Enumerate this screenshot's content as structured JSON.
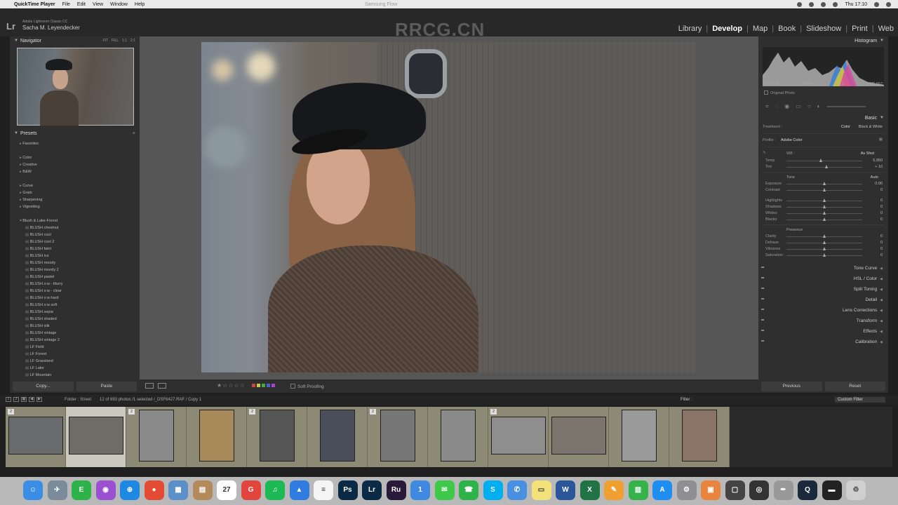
{
  "menubar": {
    "app": "QuickTime Player",
    "items": [
      "File",
      "Edit",
      "View",
      "Window",
      "Help"
    ],
    "doc_title": "Samsung Flow",
    "clock": "Thu 17:10"
  },
  "lr": {
    "product": "Adobe Lightroom Classic CC",
    "user": "Sacha M. Leyendecker",
    "watermark": "RRCG.CN",
    "modules": [
      "Library",
      "Develop",
      "Map",
      "Book",
      "Slideshow",
      "Print",
      "Web"
    ],
    "active_module": "Develop"
  },
  "left": {
    "navigator_title": "Navigator",
    "nav_opts": [
      "FIT",
      "FILL",
      "1:1",
      "2:1"
    ],
    "presets_title": "Presets",
    "presets": [
      {
        "label": "Favorites",
        "kind": "grp",
        "gap": false
      },
      {
        "label": "Color",
        "kind": "grp",
        "gap": true
      },
      {
        "label": "Creative",
        "kind": "grp",
        "gap": false
      },
      {
        "label": "B&W",
        "kind": "grp",
        "gap": false
      },
      {
        "label": "Curve",
        "kind": "grp",
        "gap": true
      },
      {
        "label": "Grain",
        "kind": "grp",
        "gap": false
      },
      {
        "label": "Sharpening",
        "kind": "grp",
        "gap": false
      },
      {
        "label": "Vignetting",
        "kind": "grp",
        "gap": false
      },
      {
        "label": "Blush & Lake-Forest",
        "kind": "open",
        "gap": true
      },
      {
        "label": "BLUSH chestnut",
        "kind": "sub",
        "gap": false
      },
      {
        "label": "BLUSH cool",
        "kind": "sub",
        "gap": false
      },
      {
        "label": "BLUSH cool 2",
        "kind": "sub",
        "gap": false
      },
      {
        "label": "BLUSH faint",
        "kind": "sub",
        "gap": false
      },
      {
        "label": "BLUSH ice",
        "kind": "sub",
        "gap": false
      },
      {
        "label": "BLUSH moody",
        "kind": "sub",
        "gap": false
      },
      {
        "label": "BLUSH moody 2",
        "kind": "sub",
        "gap": false
      },
      {
        "label": "BLUSH pastel",
        "kind": "sub",
        "gap": false
      },
      {
        "label": "BLUSH s:w - blurry",
        "kind": "sub",
        "gap": false
      },
      {
        "label": "BLUSH s:w - clear",
        "kind": "sub",
        "gap": false
      },
      {
        "label": "BLUSH s:w hard",
        "kind": "sub",
        "gap": false
      },
      {
        "label": "BLUSH s:w soft",
        "kind": "sub",
        "gap": false
      },
      {
        "label": "BLUSH sepia",
        "kind": "sub",
        "gap": false
      },
      {
        "label": "BLUSH shaded",
        "kind": "sub",
        "gap": false
      },
      {
        "label": "BLUSH silk",
        "kind": "sub",
        "gap": false
      },
      {
        "label": "BLUSH vintage",
        "kind": "sub",
        "gap": false
      },
      {
        "label": "BLUSH vintage 2",
        "kind": "sub",
        "gap": false
      },
      {
        "label": "LF Field",
        "kind": "sub",
        "gap": false
      },
      {
        "label": "LF Forest",
        "kind": "sub",
        "gap": false
      },
      {
        "label": "LF Grassland",
        "kind": "sub",
        "gap": false
      },
      {
        "label": "LF Lake",
        "kind": "sub",
        "gap": false
      },
      {
        "label": "LF Mountain",
        "kind": "sub",
        "gap": false
      }
    ],
    "copy_label": "Copy...",
    "paste_label": "Paste"
  },
  "toolbar": {
    "soft_proofing": "Soft Proofing"
  },
  "right": {
    "histogram_title": "Histogram",
    "iso": "ISO 1600",
    "focal": "56 mm",
    "aperture": "f / 1.2",
    "shutter": "1/125 SEC",
    "original_photo": "Original Photo",
    "basic_title": "Basic",
    "treatment_label": "Treatment :",
    "treatment_color": "Color",
    "treatment_bw": "Black & White",
    "profile_label": "Profile :",
    "profile_value": "Adobe Color",
    "wb_label": "WB :",
    "wb_value": "As Shot",
    "tone_label": "Tone",
    "auto_label": "Auto",
    "presence_label": "Presence",
    "wb_sliders": [
      {
        "label": "Temp",
        "value": "5,950",
        "pos": 0.45
      },
      {
        "label": "Tint",
        "value": "+ 10",
        "pos": 0.53
      }
    ],
    "tone_sliders": [
      {
        "label": "Exposure",
        "value": "0.00",
        "pos": 0.5
      },
      {
        "label": "Contrast",
        "value": "0",
        "pos": 0.5
      }
    ],
    "tone_sliders2": [
      {
        "label": "Highlights",
        "value": "0",
        "pos": 0.5
      },
      {
        "label": "Shadows",
        "value": "0",
        "pos": 0.5
      },
      {
        "label": "Whites",
        "value": "0",
        "pos": 0.5
      },
      {
        "label": "Blacks",
        "value": "0",
        "pos": 0.5
      }
    ],
    "presence_sliders": [
      {
        "label": "Clarity",
        "value": "0",
        "pos": 0.5
      },
      {
        "label": "Dehaze",
        "value": "0",
        "pos": 0.5
      },
      {
        "label": "Vibrance",
        "value": "0",
        "pos": 0.5
      },
      {
        "label": "Saturation",
        "value": "0",
        "pos": 0.5
      }
    ],
    "panels": [
      "Tone Curve",
      "HSL / Color",
      "Split Toning",
      "Detail",
      "Lens Corrections",
      "Transform",
      "Effects",
      "Calibration"
    ],
    "previous_label": "Previous",
    "reset_label": "Reset"
  },
  "filmbar": {
    "folder": "Folder : Street",
    "selection": "12 of 893 photos /1 selected /_DSF6427.RAF / Copy 1",
    "filter_label": "Filter :",
    "custom_filter": "Custom Filter",
    "page_nums": [
      "1",
      "2"
    ]
  },
  "filmstrip": {
    "frames": [
      {
        "badge": "2",
        "selected": false,
        "orient": "land",
        "tone": "#6a6b6d"
      },
      {
        "badge": "",
        "selected": true,
        "orient": "land",
        "tone": "#6f6c68"
      },
      {
        "badge": "2",
        "selected": false,
        "orient": "port",
        "tone": "#8a8a8a"
      },
      {
        "badge": "",
        "selected": false,
        "orient": "port",
        "tone": "#a88a5a"
      },
      {
        "badge": "2",
        "selected": false,
        "orient": "port",
        "tone": "#555555"
      },
      {
        "badge": "",
        "selected": false,
        "orient": "port",
        "tone": "#4a4e5a"
      },
      {
        "badge": "2",
        "selected": false,
        "orient": "port",
        "tone": "#777777"
      },
      {
        "badge": "",
        "selected": false,
        "orient": "port",
        "tone": "#8a8a8a"
      },
      {
        "badge": "2",
        "selected": false,
        "orient": "land",
        "tone": "#8e8e8e"
      },
      {
        "badge": "",
        "selected": false,
        "orient": "land",
        "tone": "#7c756e"
      },
      {
        "badge": "",
        "selected": false,
        "orient": "port",
        "tone": "#9a9a9a"
      },
      {
        "badge": "",
        "selected": false,
        "orient": "port",
        "tone": "#8a7468"
      }
    ]
  },
  "dock": {
    "apps": [
      {
        "name": "finder-icon",
        "color": "#3a8ee6",
        "glyph": "☺"
      },
      {
        "name": "launchpad-icon",
        "color": "#7c8b99",
        "glyph": "✈"
      },
      {
        "name": "evernote-icon",
        "color": "#2db34a",
        "glyph": "E"
      },
      {
        "name": "siri-icon",
        "color": "#9b4fd1",
        "glyph": "◉"
      },
      {
        "name": "safari-icon",
        "color": "#1e88e5",
        "glyph": "⊕"
      },
      {
        "name": "chrome-icon",
        "color": "#e44b35",
        "glyph": "●"
      },
      {
        "name": "preview-icon",
        "color": "#5a8fc8",
        "glyph": "▦"
      },
      {
        "name": "contacts-icon",
        "color": "#b58a5a",
        "glyph": "▤"
      },
      {
        "name": "calendar-icon",
        "color": "#ffffff",
        "glyph": "27"
      },
      {
        "name": "grammarly-icon",
        "color": "#e2453c",
        "glyph": "G"
      },
      {
        "name": "spotify-icon",
        "color": "#1db954",
        "glyph": "♫"
      },
      {
        "name": "keynote-icon",
        "color": "#2f7de1",
        "glyph": "▲"
      },
      {
        "name": "notes-icon",
        "color": "#f5f5f5",
        "glyph": "≡"
      },
      {
        "name": "photoshop-icon",
        "color": "#0b2a45",
        "glyph": "Ps"
      },
      {
        "name": "lightroom-icon",
        "color": "#0b2a45",
        "glyph": "Lr"
      },
      {
        "name": "rush-icon",
        "color": "#2a1a3a",
        "glyph": "Ru"
      },
      {
        "name": "onepassword-icon",
        "color": "#3f8ae0",
        "glyph": "1"
      },
      {
        "name": "messages-icon",
        "color": "#3ec94a",
        "glyph": "✉"
      },
      {
        "name": "facetime-icon",
        "color": "#2db34a",
        "glyph": "☎"
      },
      {
        "name": "skype-icon",
        "color": "#00aff0",
        "glyph": "S"
      },
      {
        "name": "messenger-icon",
        "color": "#4a90e2",
        "glyph": "✆"
      },
      {
        "name": "stickies-icon",
        "color": "#f3e27a",
        "glyph": "▭"
      },
      {
        "name": "word-icon",
        "color": "#2b579a",
        "glyph": "W"
      },
      {
        "name": "excel-icon",
        "color": "#217346",
        "glyph": "X"
      },
      {
        "name": "pages-icon",
        "color": "#f0a030",
        "glyph": "✎"
      },
      {
        "name": "numbers-icon",
        "color": "#36b24a",
        "glyph": "▥"
      },
      {
        "name": "appstore-icon",
        "color": "#1f8ef1",
        "glyph": "A"
      },
      {
        "name": "settings-icon",
        "color": "#8e8e93",
        "glyph": "⚙"
      },
      {
        "name": "books-icon",
        "color": "#e8843b",
        "glyph": "▣"
      },
      {
        "name": "printer-icon",
        "color": "#444444",
        "glyph": "▢"
      },
      {
        "name": "camera-icon",
        "color": "#333333",
        "glyph": "◎"
      },
      {
        "name": "feather-icon",
        "color": "#999999",
        "glyph": "✒"
      },
      {
        "name": "quicktime-icon",
        "color": "#1b2a3a",
        "glyph": "Q"
      },
      {
        "name": "display-icon",
        "color": "#222222",
        "glyph": "▬"
      },
      {
        "name": "trash-icon",
        "color": "#cfcfcf",
        "glyph": "♲"
      }
    ]
  }
}
